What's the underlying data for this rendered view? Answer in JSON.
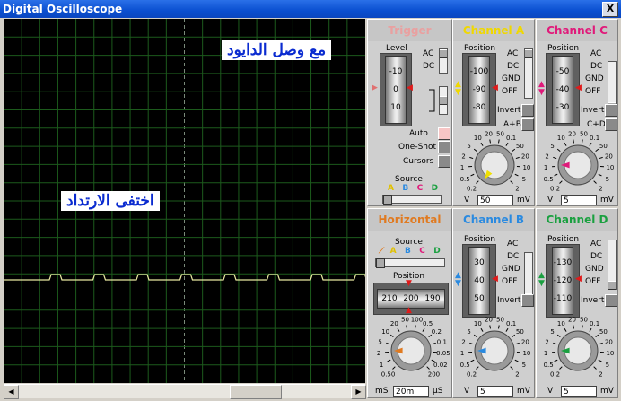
{
  "window": {
    "title": "Digital Oscilloscope",
    "close_label": "X"
  },
  "screen": {
    "label_top": "مع وصل الدايود",
    "label_left": "اختفى الارتداد",
    "trace_color": "#e8e8a0",
    "grid_color": "#1c5a1c"
  },
  "trigger": {
    "title": "Trigger",
    "level_label": "Level",
    "drum": [
      "-10",
      "0",
      "10"
    ],
    "ac": "AC",
    "dc": "DC",
    "auto": "Auto",
    "oneshot": "One-Shot",
    "cursors": "Cursors",
    "source_label": "Source",
    "sources": [
      "A",
      "B",
      "C",
      "D"
    ]
  },
  "channel_a": {
    "title": "Channel A",
    "position_label": "Position",
    "drum": [
      "-100",
      "-90",
      "-80"
    ],
    "modes": [
      "AC",
      "DC",
      "GND",
      "OFF"
    ],
    "invert": "Invert",
    "sum": "A+B",
    "value": "50",
    "unit": "mV",
    "color": "#f0e000"
  },
  "channel_c": {
    "title": "Channel C",
    "position_label": "Position",
    "drum": [
      "-50",
      "-40",
      "-30"
    ],
    "modes": [
      "AC",
      "DC",
      "GND",
      "OFF"
    ],
    "invert": "Invert",
    "sum": "C+D",
    "value": "5",
    "unit": "mV",
    "color": "#e01a7a"
  },
  "horizontal": {
    "title": "Horizontal",
    "source_label": "Source",
    "sources": [
      "A",
      "B",
      "C",
      "D"
    ],
    "position_label": "Position",
    "drum": [
      "210",
      "200",
      "190"
    ],
    "value": "20m",
    "unit_left": "mS",
    "unit_right": "µS",
    "color": "#e07a20"
  },
  "channel_b": {
    "title": "Channel B",
    "position_label": "Position",
    "drum": [
      "30",
      "40",
      "50"
    ],
    "modes": [
      "AC",
      "DC",
      "GND",
      "OFF"
    ],
    "invert": "Invert",
    "value": "5",
    "unit_left": "V",
    "unit": "mV",
    "color": "#2a8ae0"
  },
  "channel_d": {
    "title": "Channel D",
    "position_label": "Position",
    "drum": [
      "-130",
      "-120",
      "-110"
    ],
    "modes": [
      "AC",
      "DC",
      "GND",
      "OFF"
    ],
    "invert": "Invert",
    "value": "5",
    "unit_left": "V",
    "unit": "mV",
    "color": "#1aa040"
  },
  "knob_scale_a": [
    "0.2",
    "0.5",
    "1",
    "2",
    "5",
    "10",
    "20",
    "50",
    "0.1",
    "50",
    "20",
    "10",
    "5",
    "2"
  ],
  "knob_scale_h": [
    "0.50",
    "1",
    "2",
    "5",
    "10",
    "20",
    "50",
    "100",
    "0.5",
    "0.2",
    "0.1",
    "0.05",
    "0.02",
    "200"
  ]
}
